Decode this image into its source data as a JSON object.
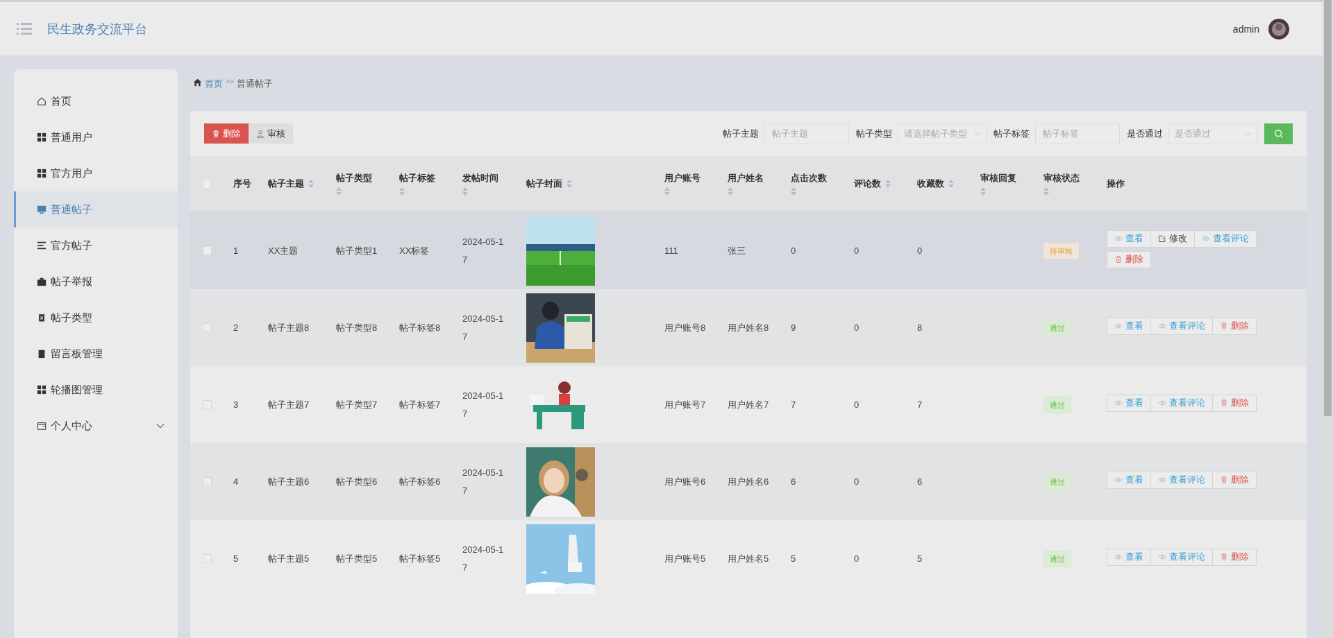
{
  "header": {
    "title": "民生政务交流平台",
    "user": "admin"
  },
  "sidebar": {
    "items": [
      {
        "label": "首页",
        "selected": false
      },
      {
        "label": "普通用户",
        "selected": false
      },
      {
        "label": "官方用户",
        "selected": false
      },
      {
        "label": "普通帖子",
        "selected": true
      },
      {
        "label": "官方帖子",
        "selected": false
      },
      {
        "label": "帖子举报",
        "selected": false
      },
      {
        "label": "帖子类型",
        "selected": false
      },
      {
        "label": "留言板管理",
        "selected": false
      },
      {
        "label": "轮播图管理",
        "selected": false
      },
      {
        "label": "个人中心",
        "selected": false,
        "expanded": false
      }
    ]
  },
  "breadcrumb": {
    "home": "首页",
    "separator": ">>",
    "current": "普通帖子"
  },
  "toolbar": {
    "buttons": [
      {
        "label": "删除",
        "kind": "danger"
      },
      {
        "label": "审核",
        "kind": "plain"
      }
    ],
    "filters": [
      {
        "label": "帖子主题",
        "placeholder": "帖子主题",
        "kind": "input"
      },
      {
        "label": "帖子类型",
        "placeholder": "请选择帖子类型",
        "kind": "select"
      },
      {
        "label": "帖子标签",
        "placeholder": "帖子标签",
        "kind": "input"
      },
      {
        "label": "是否通过",
        "placeholder": "是否通过",
        "kind": "select"
      }
    ]
  },
  "table": {
    "all_checked": false,
    "columns": [
      {
        "label": "序号",
        "sortable": false
      },
      {
        "label": "帖子主题",
        "sortable": true
      },
      {
        "label": "帖子类型",
        "sortable": true
      },
      {
        "label": "帖子标签",
        "sortable": true
      },
      {
        "label": "发帖时间",
        "sortable": true
      },
      {
        "label": "帖子封面",
        "sortable": true
      },
      {
        "label": "用户账号",
        "sortable": true
      },
      {
        "label": "用户姓名",
        "sortable": true
      },
      {
        "label": "点击次数",
        "sortable": true
      },
      {
        "label": "评论数",
        "sortable": true
      },
      {
        "label": "收藏数",
        "sortable": true
      },
      {
        "label": "审核回复",
        "sortable": true
      },
      {
        "label": "审核状态",
        "sortable": true
      },
      {
        "label": "操作",
        "sortable": false
      }
    ],
    "rows": [
      {
        "checked": false,
        "hovered": true,
        "cells": [
          "1",
          "XX主题",
          "帖子类型1",
          "XX标签",
          "2024-05-17"
        ],
        "cover": {
          "kind": "picture"
        },
        "cells2": [
          "111",
          "张三",
          "0",
          "0",
          "0"
        ],
        "status": {
          "label": "待审核",
          "kind": "pending"
        },
        "actions": [
          {
            "label": "查看",
            "kind": "view"
          },
          {
            "label": "修改",
            "kind": "edit"
          },
          {
            "label": "查看评论",
            "kind": "view"
          },
          {
            "label": "删除",
            "kind": "delete"
          }
        ]
      },
      {
        "checked": false,
        "hovered": false,
        "cells": [
          "2",
          "帖子主题8",
          "帖子类型8",
          "帖子标签8",
          "2024-05-17"
        ],
        "cover": {
          "kind": "picture"
        },
        "cells2": [
          "用户账号8",
          "用户姓名8",
          "9",
          "0",
          "8"
        ],
        "status": {
          "label": "通过",
          "kind": "approved"
        },
        "actions": [
          {
            "label": "查看",
            "kind": "view"
          },
          {
            "label": "查看评论",
            "kind": "view"
          },
          {
            "label": "删除",
            "kind": "delete"
          }
        ]
      },
      {
        "checked": false,
        "hovered": false,
        "cells": [
          "3",
          "帖子主题7",
          "帖子类型7",
          "帖子标签7",
          "2024-05-17"
        ],
        "cover": {
          "kind": "picture"
        },
        "cells2": [
          "用户账号7",
          "用户姓名7",
          "7",
          "0",
          "7"
        ],
        "status": {
          "label": "通过",
          "kind": "approved"
        },
        "actions": [
          {
            "label": "查看",
            "kind": "view"
          },
          {
            "label": "查看评论",
            "kind": "view"
          },
          {
            "label": "删除",
            "kind": "delete"
          }
        ]
      },
      {
        "checked": false,
        "hovered": false,
        "cells": [
          "4",
          "帖子主题6",
          "帖子类型6",
          "帖子标签6",
          "2024-05-17"
        ],
        "cover": {
          "kind": "picture"
        },
        "cells2": [
          "用户账号6",
          "用户姓名6",
          "6",
          "0",
          "6"
        ],
        "status": {
          "label": "通过",
          "kind": "approved"
        },
        "actions": [
          {
            "label": "查看",
            "kind": "view"
          },
          {
            "label": "查看评论",
            "kind": "view"
          },
          {
            "label": "删除",
            "kind": "delete"
          }
        ]
      },
      {
        "checked": false,
        "hovered": false,
        "cells": [
          "5",
          "帖子主题5",
          "帖子类型5",
          "帖子标签5",
          "2024-05-17"
        ],
        "cover": {
          "kind": "picture"
        },
        "cells2": [
          "用户账号5",
          "用户姓名5",
          "5",
          "0",
          "5"
        ],
        "status": {
          "label": "通过",
          "kind": "approved"
        },
        "actions": [
          {
            "label": "查看",
            "kind": "view"
          },
          {
            "label": "查看评论",
            "kind": "view"
          },
          {
            "label": "删除",
            "kind": "delete"
          }
        ]
      }
    ]
  }
}
